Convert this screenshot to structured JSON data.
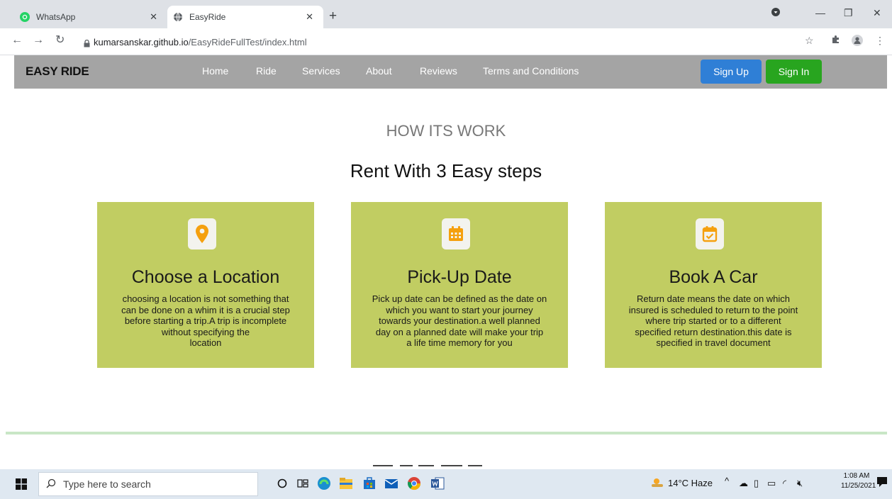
{
  "browser": {
    "tabs": [
      {
        "title": "WhatsApp",
        "active": false
      },
      {
        "title": "EasyRide",
        "active": true
      }
    ],
    "url_host": "kumarsanskar.github.io",
    "url_path": "/EasyRideFullTest/index.html"
  },
  "site": {
    "brand": "EASY RIDE",
    "nav": [
      "Home",
      "Ride",
      "Services",
      "About",
      "Reviews",
      "Terms and Conditions"
    ],
    "signup_label": "Sign Up",
    "signin_label": "Sign In"
  },
  "section": {
    "kicker": "HOW ITS WORK",
    "title": "Rent With 3 Easy steps",
    "cards": [
      {
        "icon": "location-pin-icon",
        "title": "Choose a Location",
        "lines": [
          "choosing a location is not something that",
          "can be done on a whim it is a crucial step",
          "before starting a trip.A trip is incomplete",
          "without specifying the",
          "location"
        ]
      },
      {
        "icon": "calendar-icon",
        "title": "Pick-Up Date",
        "lines": [
          "Pick up date can be defined as the date on",
          "which you want to start your journey",
          "towards your destination.a well planned",
          "day on a planned date will make your trip",
          "a life time memory for you"
        ]
      },
      {
        "icon": "calendar-check-icon",
        "title": "Book A Car",
        "lines": [
          "Return date means the date on which",
          "insured is scheduled to return to the point",
          "where trip started or to a different",
          "specified return destination.this date is",
          "specified in travel document"
        ]
      }
    ]
  },
  "taskbar": {
    "search_placeholder": "Type here to search",
    "weather": "14°C  Haze",
    "time": "1:08 AM",
    "date": "11/25/2021"
  },
  "colors": {
    "nav_bg": "#a4a4a4",
    "card_bg": "#c1cd62",
    "icon_orange": "#f5a00e",
    "signup": "#2f7fd6",
    "signin": "#28a51f",
    "divider": "#c9e6c6"
  }
}
